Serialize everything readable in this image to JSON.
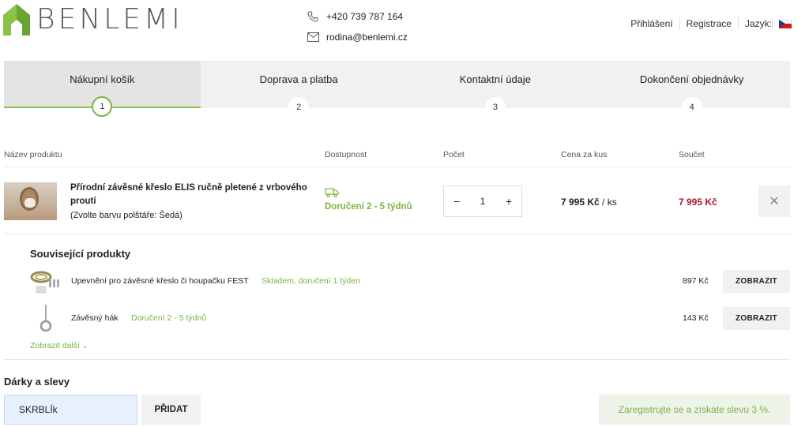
{
  "header": {
    "logo_text": "BENLEMI",
    "phone": "+420 739 787 164",
    "email": "rodina@benlemi.cz",
    "links": {
      "login": "Přihlášení",
      "register": "Registrace",
      "language_label": "Jazyk:"
    },
    "language_flag": "czech-flag-icon"
  },
  "steps": [
    {
      "label": "Nákupní košík",
      "number": "1",
      "active": true
    },
    {
      "label": "Doprava a platba",
      "number": "2",
      "active": false
    },
    {
      "label": "Kontaktní údaje",
      "number": "3",
      "active": false
    },
    {
      "label": "Dokončení objednávky",
      "number": "4",
      "active": false
    }
  ],
  "cart_table": {
    "columns": [
      "Název produktu",
      "Dostupnost",
      "Počet",
      "Cena za kus",
      "Součet"
    ],
    "items": [
      {
        "name": "Přírodní závěsné křeslo ELIS ručně pletené z vrbového proutí",
        "note": "(Zvolte barvu polštáře: Šedá)",
        "availability": "Doručení 2 - 5 týdnů",
        "quantity": "1",
        "unit_price": "7 995 Kč",
        "unit_suffix": "/ ks",
        "total": "7 995 Kč"
      }
    ]
  },
  "related": {
    "title": "Související produkty",
    "items": [
      {
        "name": "Upevnění pro závěsné křeslo či houpačku FEST",
        "availability": "Skladem, doručení 1 týden",
        "price": "897 Kč",
        "button": "ZOBRAZIT"
      },
      {
        "name": "Závěsný hák",
        "availability": "Doručení 2 - 5 týdnů",
        "price": "143 Kč",
        "button": "ZOBRAZIT"
      }
    ],
    "more": "Zobrazit další"
  },
  "gifts": {
    "title": "Dárky a slevy",
    "code_value": "SKRBLÍk",
    "add_button": "PŘIDAT",
    "register_promo": "Zaregistrujte se a získáte slevu 3 %."
  },
  "colors": {
    "accent_green": "#7cb342",
    "price_red": "#a0182a"
  }
}
